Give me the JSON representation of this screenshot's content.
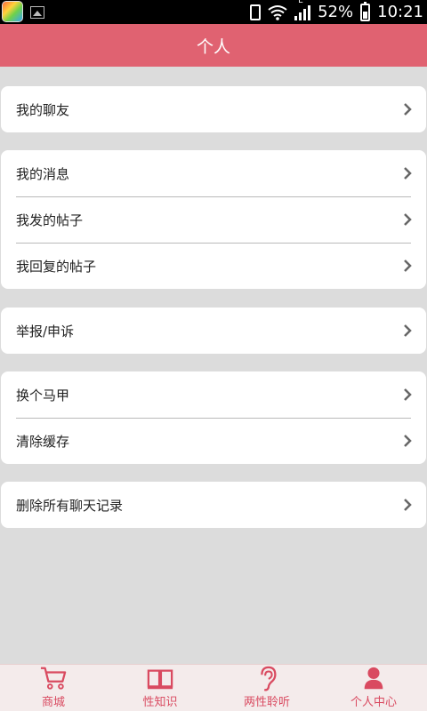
{
  "status_bar": {
    "battery": "52%",
    "time": "10:21",
    "network": "E"
  },
  "header": {
    "title": "个人"
  },
  "groups": [
    {
      "items": [
        {
          "label": "我的聊友"
        }
      ]
    },
    {
      "items": [
        {
          "label": "我的消息"
        },
        {
          "label": "我发的帖子"
        },
        {
          "label": "我回复的帖子"
        }
      ]
    },
    {
      "items": [
        {
          "label": "举报/申诉"
        }
      ]
    },
    {
      "items": [
        {
          "label": "换个马甲"
        },
        {
          "label": "清除缓存"
        }
      ]
    },
    {
      "items": [
        {
          "label": "删除所有聊天记录"
        }
      ]
    }
  ],
  "bottom_nav": {
    "items": [
      {
        "label": "商城",
        "icon": "cart-icon"
      },
      {
        "label": "性知识",
        "icon": "book-icon"
      },
      {
        "label": "两性聆听",
        "icon": "ear-icon"
      },
      {
        "label": "个人中心",
        "icon": "person-icon"
      }
    ]
  },
  "colors": {
    "accent": "#e06271",
    "nav_text": "#d94a60",
    "background": "#dcdcdc"
  }
}
